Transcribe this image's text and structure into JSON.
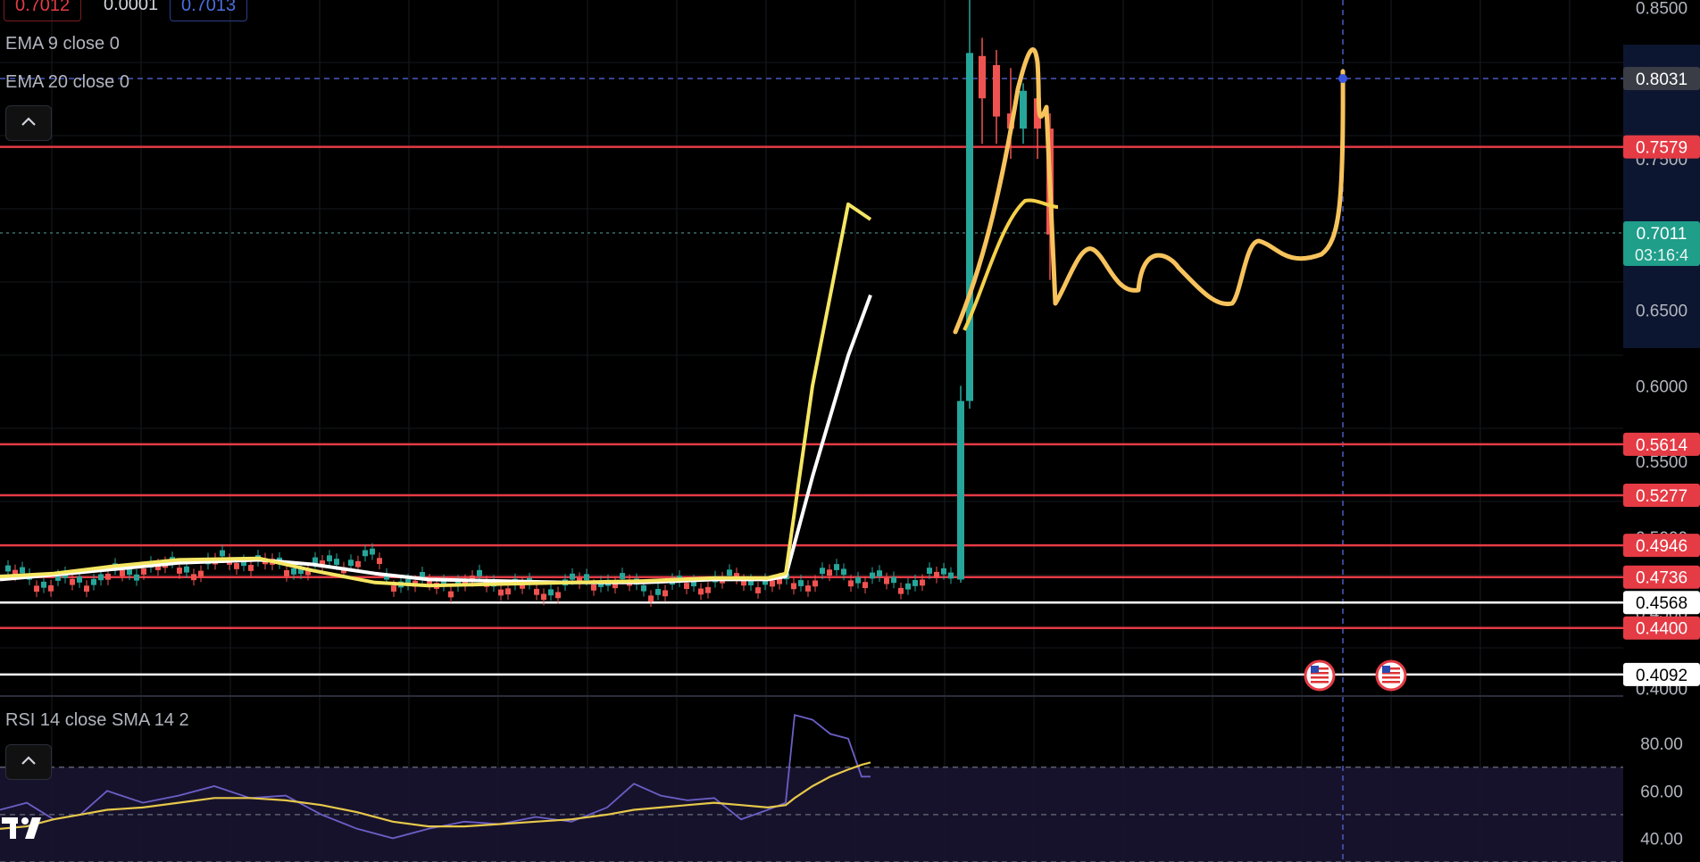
{
  "top_chips": [
    "0.7012",
    "0.0001",
    "0.7013"
  ],
  "legends": {
    "ema9": "EMA 9 close 0",
    "ema20": "EMA 20 close 0",
    "rsi": "RSI 14 close SMA 14 2"
  },
  "countdown": "03:16:4",
  "logo_text": "TV",
  "colors": {
    "background": "#000000",
    "level_line": "#e53b45",
    "support_line": "#e8e8e8",
    "up_candle": "#26a69a",
    "down_candle": "#ef5350",
    "ema9": "#f5e663",
    "ema20": "#ffffff",
    "drawing": "#f7c35c",
    "rsi": "#6a5fc7",
    "rsi_sma": "#e6c84a",
    "crosshair": "#4a5bbd"
  },
  "chart_data": [
    {
      "type": "line",
      "pane": "price",
      "ylim": [
        0.395,
        0.855
      ],
      "price_axis_ticks": [
        "0.8500",
        "0.7500",
        "0.6500",
        "0.6000",
        "0.5500",
        "0.5000",
        "0.4500",
        "0.4000"
      ],
      "horizontal_levels": [
        {
          "value": 0.7579,
          "label": "0.7579",
          "color": "#e53b45"
        },
        {
          "value": 0.5614,
          "label": "0.5614",
          "color": "#e53b45"
        },
        {
          "value": 0.5277,
          "label": "0.5277",
          "color": "#e53b45"
        },
        {
          "value": 0.4946,
          "label": "0.4946",
          "color": "#e53b45"
        },
        {
          "value": 0.4736,
          "label": "0.4736",
          "color": "#e53b45"
        },
        {
          "value": 0.4568,
          "label": "0.4568",
          "color": "#ffffff"
        },
        {
          "value": 0.44,
          "label": "0.4400",
          "color": "#e53b45"
        },
        {
          "value": 0.4092,
          "label": "0.4092",
          "color": "#ffffff"
        }
      ],
      "crosshair_price": {
        "value": 0.8031,
        "label": "0.8031"
      },
      "last_price": {
        "value": 0.7011,
        "label": "0.7011"
      },
      "series": [
        {
          "name": "EMA 9",
          "values": [
            0.474,
            0.476,
            0.481,
            0.485,
            0.486,
            0.478,
            0.47,
            0.468,
            0.469,
            0.47,
            0.471,
            0.473,
            0.473,
            0.476,
            0.6,
            0.72,
            0.71
          ]
        },
        {
          "name": "EMA 20",
          "values": [
            0.472,
            0.475,
            0.479,
            0.483,
            0.485,
            0.482,
            0.476,
            0.472,
            0.471,
            0.47,
            0.47,
            0.472,
            0.472,
            0.474,
            0.54,
            0.62,
            0.66
          ]
        }
      ],
      "x": [
        0,
        60,
        130,
        200,
        290,
        350,
        420,
        480,
        560,
        640,
        720,
        800,
        860,
        880,
        910,
        950,
        975
      ]
    },
    {
      "type": "line",
      "pane": "rsi",
      "ylim": [
        30,
        100
      ],
      "rsi_axis_ticks": [
        "80.00",
        "60.00",
        "40.00"
      ],
      "x": [
        0,
        30,
        60,
        90,
        120,
        160,
        200,
        240,
        280,
        320,
        360,
        400,
        440,
        480,
        520,
        560,
        600,
        640,
        680,
        710,
        740,
        770,
        800,
        830,
        860,
        880,
        890,
        910,
        930,
        950,
        965,
        975
      ],
      "series": [
        {
          "name": "RSI",
          "values": [
            52,
            55,
            48,
            50,
            60,
            55,
            58,
            62,
            57,
            58,
            50,
            44,
            40,
            44,
            47,
            46,
            49,
            47,
            53,
            63,
            58,
            56,
            57,
            48,
            52,
            55,
            92,
            90,
            84,
            82,
            66,
            66
          ]
        },
        {
          "name": "SMA",
          "values": [
            44,
            45,
            48,
            50,
            52,
            53,
            55,
            57,
            57,
            56,
            54,
            51,
            47,
            45,
            45,
            46,
            47,
            48,
            50,
            52,
            53,
            54,
            55,
            54,
            53,
            54,
            57,
            62,
            66,
            69,
            71,
            72
          ]
        }
      ]
    }
  ]
}
